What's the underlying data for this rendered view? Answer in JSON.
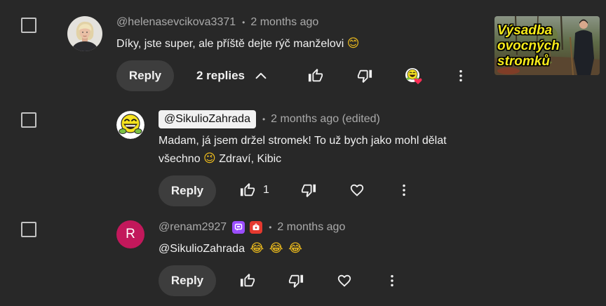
{
  "colors": {
    "background": "#282828",
    "text_primary": "#f1f1f1",
    "text_secondary": "#aaaaaa",
    "reply_button_bg": "#3d3d3d",
    "owner_chip_bg": "#f1f1f1",
    "letter_avatar_bg": "#c2185b",
    "heart_red": "#ff2d55",
    "thumbnail_title": "#f5ea1a"
  },
  "comments": [
    {
      "selected": false,
      "avatar_icon": "profile-photo-icon",
      "author": "@helenasevcikova3371",
      "separator": "•",
      "time": "2 months ago",
      "text": "Díky, jste super, ale příště dejte rýč manželovi",
      "emoji": "😊",
      "reply_label": "Reply",
      "replies_toggle": {
        "label": "2 replies",
        "icon": "chevron-up-icon",
        "expanded": true
      },
      "actions": [
        "thumb-up-icon",
        "thumb-down-icon",
        "creator-heart-icon",
        "more-vert-icon"
      ],
      "creator_hearted": true,
      "video": {
        "thumbnail_title": [
          "Výsadba",
          "ovocných",
          "stromků"
        ]
      }
    },
    {
      "selected": false,
      "avatar_icon": "laughing-smiley-icon",
      "author": "@SikulioZahrada",
      "author_is_channel_owner": true,
      "separator": "•",
      "time": "2 months ago (edited)",
      "text_line1": "Madam, já jsem držel stromek! To už bych jako mohl dělat",
      "text_line2_start": "všechno",
      "emoji": "😉",
      "text_line2_end": "Zdraví, Kibic",
      "reply_label": "Reply",
      "like_count": "1",
      "actions": [
        "thumb-up-icon",
        "thumb-down-icon",
        "heart-outline-icon",
        "more-vert-icon"
      ]
    },
    {
      "selected": false,
      "avatar_letter": "R",
      "author": "@renam2927",
      "badges": [
        "purple-member-badge-icon",
        "red-member-badge-icon"
      ],
      "separator": "•",
      "time": "2 months ago",
      "text": "@SikulioZahrada",
      "emojis": [
        "😂",
        "😂",
        "😂"
      ],
      "reply_label": "Reply",
      "actions": [
        "thumb-up-icon",
        "thumb-down-icon",
        "heart-outline-icon",
        "more-vert-icon"
      ]
    }
  ]
}
